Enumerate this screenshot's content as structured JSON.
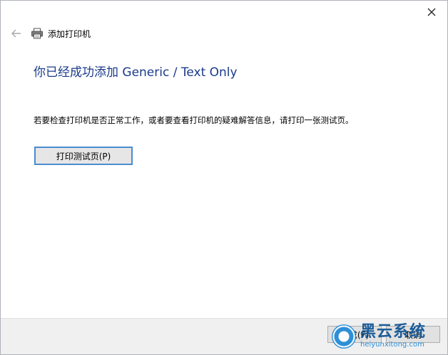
{
  "window": {
    "close_icon": "close-icon"
  },
  "header": {
    "back_icon": "back-arrow-icon",
    "printer_icon": "printer-icon",
    "title": "添加打印机"
  },
  "main": {
    "heading": "你已经成功添加 Generic / Text Only",
    "info": "若要检查打印机是否正常工作，或者要查看打印机的疑难解答信息，请打印一张测试页。",
    "print_test_button": "打印测试页(P)"
  },
  "footer": {
    "finish_button": "完成(F)",
    "cancel_button": "取消"
  },
  "watermark": {
    "title": "黑云系统",
    "url": "heiyunxitong.com"
  },
  "colors": {
    "heading": "#1a3a8a",
    "accent_border": "#4a8ccf",
    "footer_bg": "#f0f0f0"
  }
}
